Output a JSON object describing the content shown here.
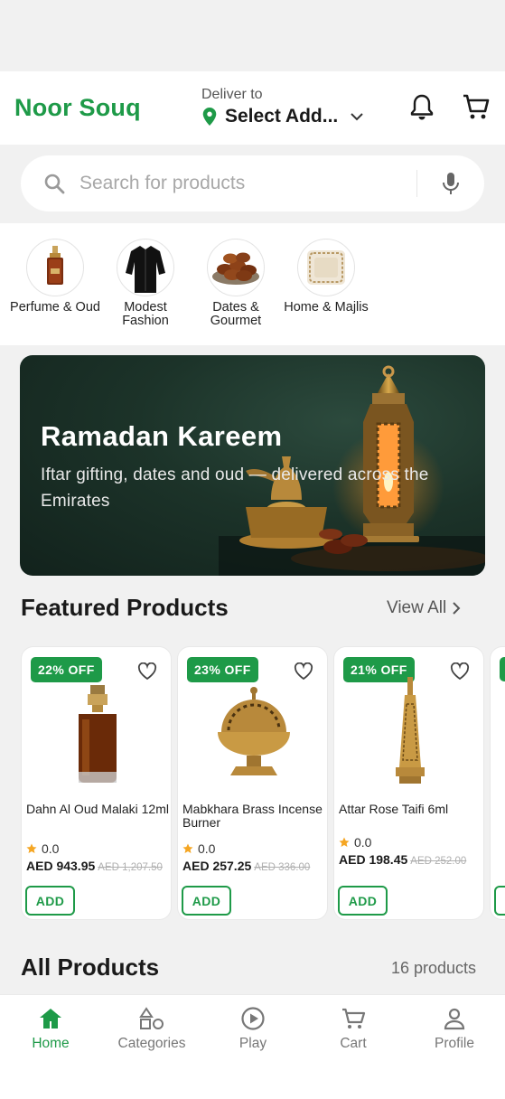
{
  "header": {
    "brand": "Noor Souq",
    "deliver_label": "Deliver to",
    "deliver_value": "Select Add...",
    "icons": {
      "pin": "location-pin-icon",
      "chevron": "chevron-down-icon",
      "bell": "bell-icon",
      "cart": "cart-icon"
    }
  },
  "search": {
    "placeholder": "Search for products",
    "icon": "search-icon",
    "mic": "mic-icon"
  },
  "categories": [
    {
      "label": "Perfume & Oud"
    },
    {
      "label": "Modest Fashion"
    },
    {
      "label": "Dates & Gourmet"
    },
    {
      "label": "Home & Majlis"
    }
  ],
  "banner": {
    "title": "Ramadan Kareem",
    "subtitle": "Iftar gifting, dates and oud — delivered across the Emirates"
  },
  "featured": {
    "title": "Featured Products",
    "view_all": "View All",
    "products": [
      {
        "badge": "22% OFF",
        "name": "Dahn Al Oud Malaki 12ml",
        "rating": "0.0",
        "price": "AED 943.95",
        "old_price": "AED 1,207.50",
        "add": "ADD"
      },
      {
        "badge": "23% OFF",
        "name": "Mabkhara Brass Incense Burner",
        "rating": "0.0",
        "price": "AED 257.25",
        "old_price": "AED 336.00",
        "add": "ADD"
      },
      {
        "badge": "21% OFF",
        "name": "Attar Rose Taifi 6ml",
        "rating": "0.0",
        "price": "AED 198.45",
        "old_price": "AED 252.00",
        "add": "ADD"
      }
    ]
  },
  "all_products": {
    "title": "All Products",
    "count": "16 products"
  },
  "bottom_nav": [
    {
      "label": "Home",
      "icon": "home-icon",
      "active": true
    },
    {
      "label": "Categories",
      "icon": "categories-icon"
    },
    {
      "label": "Play",
      "icon": "play-icon"
    },
    {
      "label": "Cart",
      "icon": "cart-icon"
    },
    {
      "label": "Profile",
      "icon": "profile-icon"
    }
  ],
  "colors": {
    "brand_green": "#1e9a48",
    "star": "#f5a623"
  }
}
